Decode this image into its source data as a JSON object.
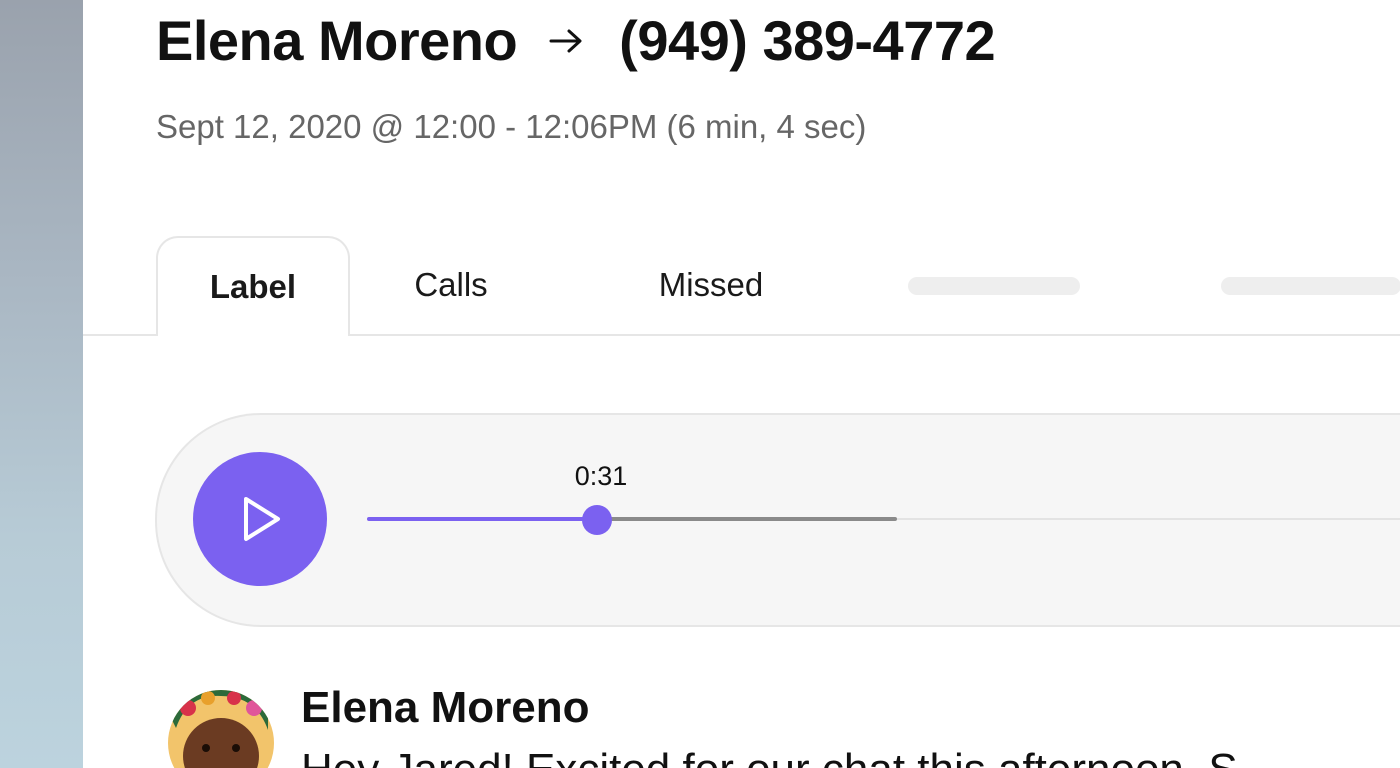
{
  "call": {
    "caller_name": "Elena Moreno",
    "phone_number": "(949) 389-4772",
    "datetime": "Sept 12, 2020 @ 12:00 - 12:06PM (6 min, 4 sec)"
  },
  "tabs": [
    {
      "label": "Label",
      "active": true
    },
    {
      "label": "Calls",
      "active": false
    },
    {
      "label": "Missed",
      "active": false
    }
  ],
  "player": {
    "current_time": "0:31",
    "progress_fraction": 0.23,
    "accent_color": "#7b61f0",
    "play_icon": "play-icon"
  },
  "message": {
    "author": "Elena Moreno",
    "text": "Hey Jared! Excited for our chat this afternoon. S"
  },
  "colors": {
    "accent": "#7b61f0",
    "text_primary": "#111111",
    "text_secondary": "#666666"
  }
}
